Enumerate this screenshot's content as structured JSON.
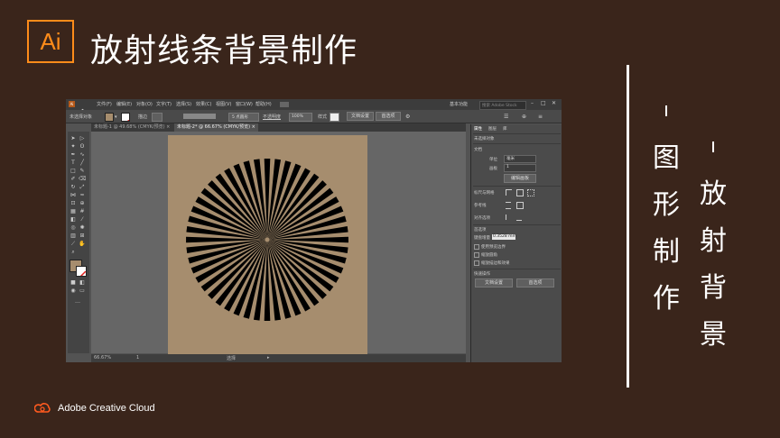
{
  "slide": {
    "logo_text": "Ai",
    "title": "放射线条背景制作",
    "vertical_left": [
      "图",
      "形",
      "制",
      "作"
    ],
    "vertical_right": [
      "放",
      "射",
      "背",
      "景"
    ],
    "brand": "Adobe Creative Cloud",
    "accent_color": "#ff8c1a",
    "background_color": "#3a251b"
  },
  "menubar": {
    "app_badge": "Ai",
    "items": [
      "文件(F)",
      "编辑(E)",
      "对象(O)",
      "文字(T)",
      "选择(S)",
      "效果(C)",
      "视图(V)",
      "窗口(W)",
      "帮助(H)"
    ],
    "workspace": "基本功能",
    "search_placeholder": "搜索 Adobe Stock"
  },
  "controlbar": {
    "selection_label": "未选择对象",
    "stroke_label": "描边",
    "stroke_style": "5 点圆形",
    "opacity_label": "不透明度",
    "opacity_value": "100%",
    "style_label": "样式",
    "doc_setup_button": "文档设置",
    "prefs_button": "首选项"
  },
  "tabs": [
    {
      "label": "未标题-1 @ 49.68% (CMYK/预览)",
      "active": false
    },
    {
      "label": "未标题-2* @ 66.67% (CMYK/预览)",
      "active": true
    }
  ],
  "statusbar": {
    "zoom": "66.67%",
    "page": "1",
    "tool": "选择"
  },
  "panel": {
    "tabs": [
      "属性",
      "图层",
      "库"
    ],
    "no_selection": "未选择对象",
    "document_section": "文档",
    "unit_label": "单位",
    "unit_value": "毫米",
    "artboard_label": "画板",
    "artboard_value": "1",
    "edit_artboard_button": "编辑画板",
    "rulers_grids": "标尺与网格",
    "guides": "参考线",
    "align_to": "对齐选项",
    "preferences_section": "首选项",
    "keyboard_increment_label": "键盘增量",
    "keyboard_increment_value": "0.3528 mm",
    "checkbox_1": "使用预览边界",
    "checkbox_2": "缩放圆角",
    "checkbox_3": "缩放描边和效果",
    "quick_actions": "快速操作",
    "doc_setup_button": "文档设置",
    "prefs_button": "首选项"
  },
  "starburst": {
    "ray_count": 48,
    "ray_color": "#000000"
  }
}
